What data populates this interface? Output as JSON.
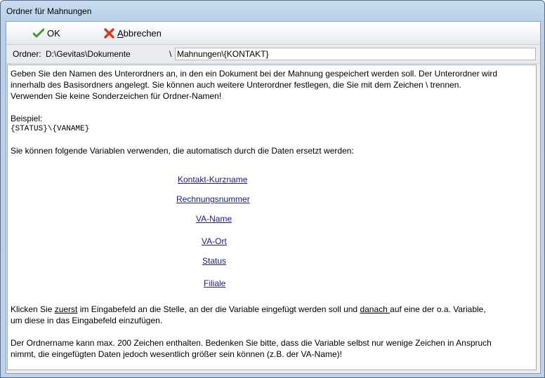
{
  "window": {
    "title": "Ordner für Mahnungen"
  },
  "toolbar": {
    "ok_label": "OK",
    "cancel_label_underlined": "A",
    "cancel_label_rest": "bbrechen"
  },
  "folder": {
    "label": "Ordner:",
    "base_path": "D:\\Gevitas\\Dokumente",
    "separator": "\\",
    "subfolder_value": "Mahnungen\\{KONTAKT}"
  },
  "help": {
    "intro_line1": "Geben Sie den Namen des Unterordners an, in den ein Dokument bei der Mahnung gespeichert werden soll. Der Unterordner wird",
    "intro_line2": "innerhalb des Basisordners angelegt. Sie können auch weitere Unterordner festlegen, die Sie mit dem Zeichen \\ trennen.",
    "intro_line3": "Verwenden Sie keine Sonderzeichen für Ordner-Namen!",
    "example_label": "Beispiel:",
    "example_code": "{STATUS}\\{VANAME}",
    "variables_intro": "Sie können folgende Variablen verwenden, die automatisch durch die Daten ersetzt werden:",
    "variables": [
      "Kontakt-Kurzname",
      "Rechnungsnummer",
      "VA-Name",
      "VA-Ort",
      "Status",
      "Filiale"
    ],
    "click_pre": "Klicken Sie ",
    "click_first": "zuerst",
    "click_mid": " im Eingabefeld an die Stelle, an der die Variable eingefügt werden soll und ",
    "click_then": "danach ",
    "click_post": "auf eine der o.a. Variable,",
    "click_line2": "um diese in das Eingabefeld einzufügen.",
    "limit_line1": "Der Ordnername kann max. 200 Zeichen enthalten. Bedenken Sie bitte, dass die Variable selbst nur wenige Zeichen in Anspruch",
    "limit_line2": "nimmt, die eingefügten Daten jedoch wesentlich größer sein können (z.B. der VA-Name)!"
  }
}
